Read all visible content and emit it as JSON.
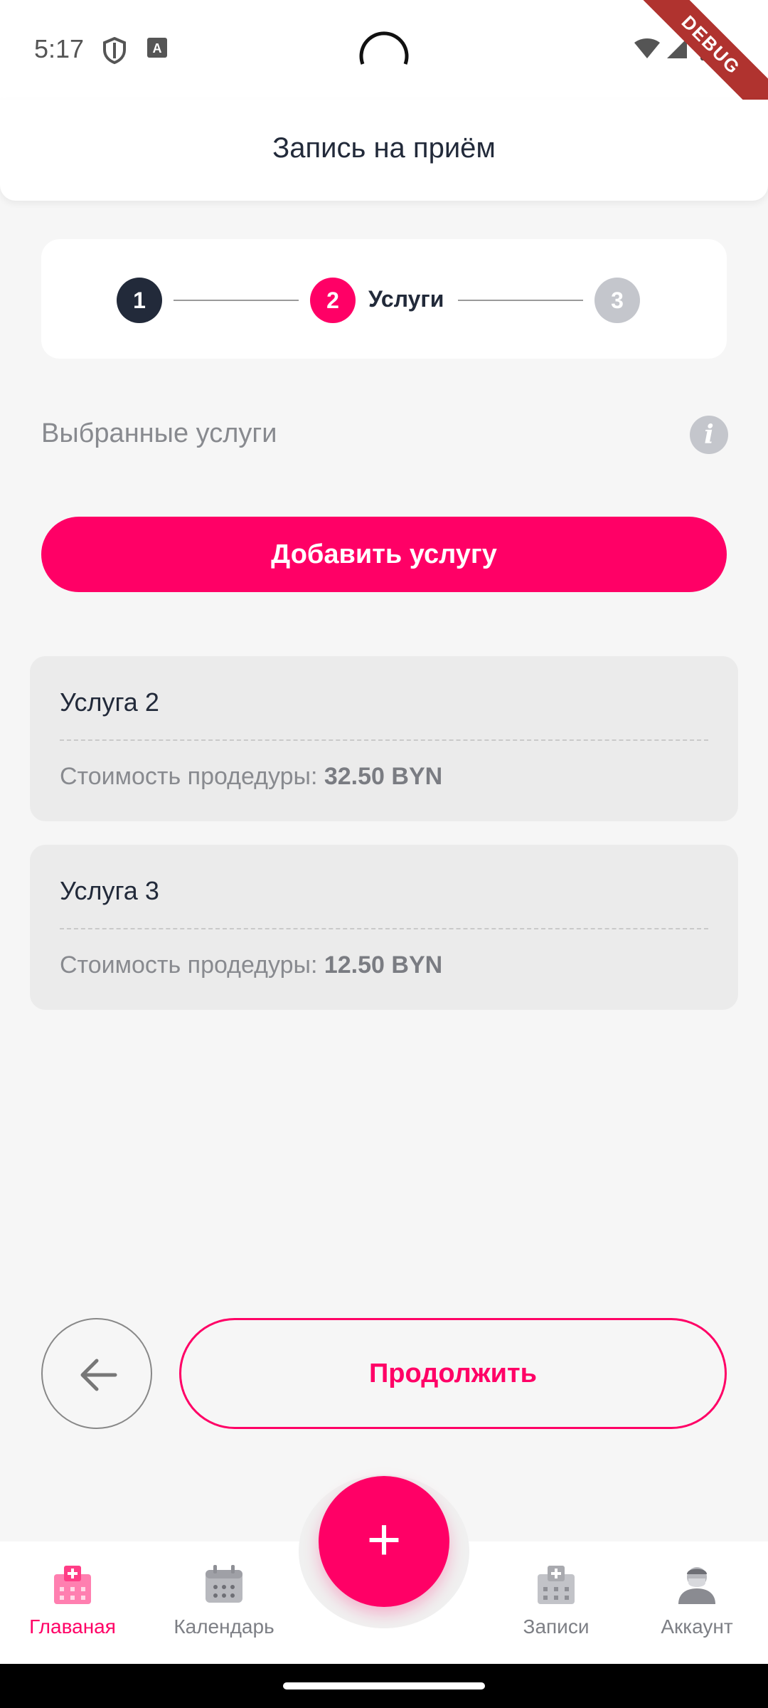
{
  "status": {
    "time": "5:17",
    "debug_label": "DEBUG"
  },
  "header": {
    "title": "Запись на приём"
  },
  "stepper": {
    "steps": [
      {
        "number": "1",
        "state": "done"
      },
      {
        "number": "2",
        "state": "active",
        "label": "Услуги"
      },
      {
        "number": "3",
        "state": "pending"
      }
    ]
  },
  "section": {
    "title": "Выбранные услуги",
    "info_icon": "i"
  },
  "add_button": {
    "label": "Добавить услугу"
  },
  "services": [
    {
      "name": "Услуга 2",
      "price_label": "Стоимость продедуры:",
      "price_value": "32.50 BYN"
    },
    {
      "name": "Услуга 3",
      "price_label": "Стоимость продедуры:",
      "price_value": "12.50 BYN"
    }
  ],
  "actions": {
    "back_icon": "arrow-left-icon",
    "continue_label": "Продолжить"
  },
  "fab": {
    "label": "+"
  },
  "nav": {
    "items": [
      {
        "label": "Главаная",
        "icon": "hospital-icon",
        "active": true
      },
      {
        "label": "Календарь",
        "icon": "calendar-icon",
        "active": false
      },
      {
        "label": "Записи",
        "icon": "records-icon",
        "active": false
      },
      {
        "label": "Аккаунт",
        "icon": "doctor-icon",
        "active": false
      }
    ]
  },
  "colors": {
    "accent": "#ff0066",
    "dark": "#222a3a",
    "muted": "#888a8f",
    "inactive_step": "#c4c6cc"
  }
}
